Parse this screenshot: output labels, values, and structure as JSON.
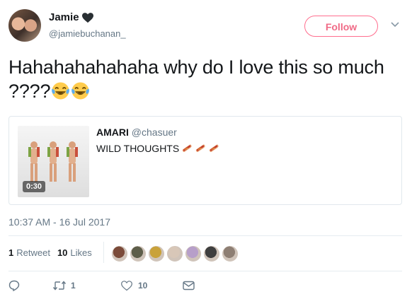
{
  "author": {
    "display_name": "Jamie",
    "handle": "@jamiebuchanan_",
    "heart_icon": "black-heart-icon"
  },
  "follow_label": "Follow",
  "tweet_text": "Hahahahahahaha why do I love this so much ????",
  "emojis": [
    "face-with-tears-of-joy",
    "face-with-tears-of-joy"
  ],
  "quoted_tweet": {
    "name": "AMARI",
    "handle": "@chasuer",
    "text": "WILD THOUGHTS",
    "hotdog_count": 3,
    "video_duration": "0:30"
  },
  "timestamp": "10:37 AM - 16 Jul 2017",
  "stats": {
    "retweets_count": "1",
    "retweets_label": "Retweet",
    "likes_count": "10",
    "likes_label": "Likes"
  },
  "likers": [
    "#7b4b3a",
    "#5e5e4a",
    "#c9a23b",
    "#d8c7b8",
    "#b79fc9",
    "#3f3f3f",
    "#8e7f74"
  ],
  "actions": {
    "reply_icon": "reply-icon",
    "retweet_count": "1",
    "like_count": "10",
    "dm_icon": "envelope-icon"
  },
  "colors": {
    "follow_accent": "#ff6e8e",
    "secondary_text": "#657786"
  }
}
